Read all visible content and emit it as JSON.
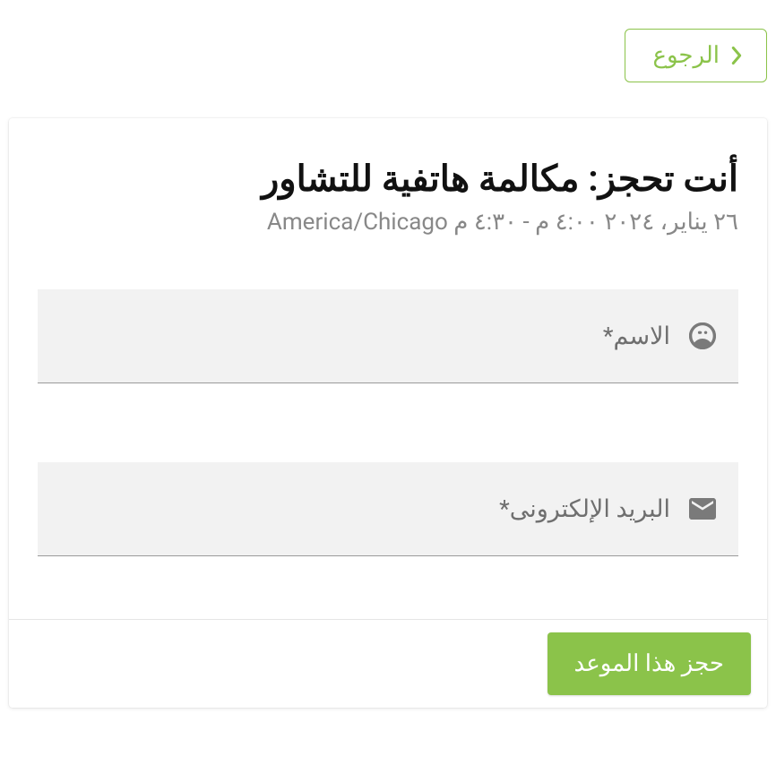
{
  "back": {
    "label": "الرجوع"
  },
  "header": {
    "title": "أنت تحجز: مكالمة هاتفية للتشاور",
    "subtitle": "٢٦ يناير، ٢٠٢٤ ٤:٠٠ م - ٤:٣٠ م America/Chicago"
  },
  "form": {
    "name": {
      "label": "الاسم*",
      "value": ""
    },
    "email": {
      "label": "البريد الإلكترونى*",
      "value": ""
    }
  },
  "submit": {
    "label": "حجز هذا الموعد"
  }
}
